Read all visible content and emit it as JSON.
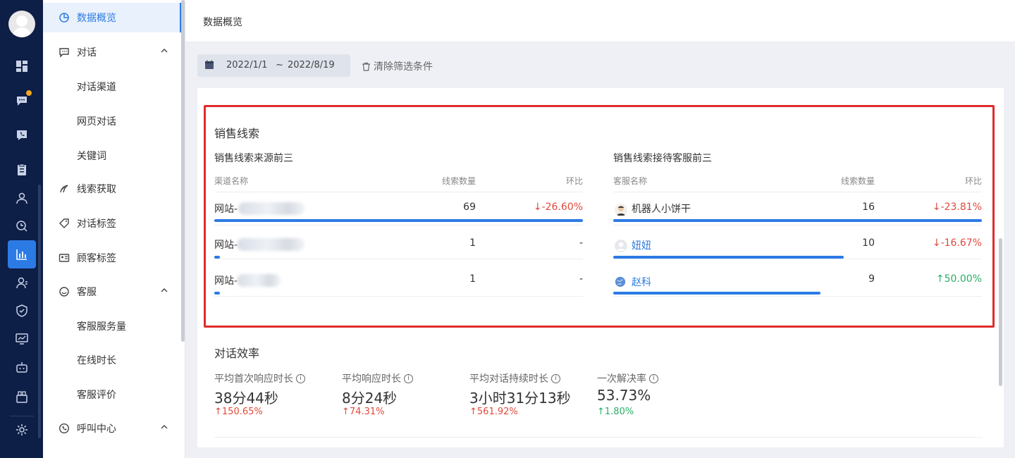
{
  "header": {
    "title": "数据概览"
  },
  "menu": {
    "items": [
      {
        "label": "数据概览",
        "icon": "pie-chart-icon"
      },
      {
        "label": "对话",
        "icon": "chat-bubble-icon"
      },
      {
        "label": "对话渠道"
      },
      {
        "label": "网页对话"
      },
      {
        "label": "关键词"
      },
      {
        "label": "线索获取",
        "icon": "lead-icon"
      },
      {
        "label": "对话标签",
        "icon": "tag-icon"
      },
      {
        "label": "顾客标签",
        "icon": "id-card-icon"
      },
      {
        "label": "客服",
        "icon": "service-icon"
      },
      {
        "label": "客服服务量"
      },
      {
        "label": "在线时长"
      },
      {
        "label": "客服评价"
      },
      {
        "label": "呼叫中心",
        "icon": "phone-icon"
      }
    ]
  },
  "filter": {
    "date_start": "2022/1/1",
    "date_sep": "~",
    "date_end": "2022/8/19",
    "clear_label": "清除筛选条件"
  },
  "sales_leads": {
    "title": "销售线索",
    "sources": {
      "title": "销售线索来源前三",
      "headers": [
        "渠道名称",
        "线索数量",
        "环比"
      ],
      "rows": [
        {
          "name": "网站-",
          "count": "69",
          "change": "-26.60%",
          "direction": "down",
          "share": 1.0
        },
        {
          "name": "网站-",
          "count": "1",
          "change": "-",
          "direction": "none",
          "share": 0.015
        },
        {
          "name": "网站-",
          "count": "1",
          "change": "-",
          "direction": "none",
          "share": 0.015
        }
      ]
    },
    "agents": {
      "title": "销售线索接待客服前三",
      "headers": [
        "客服名称",
        "线索数量",
        "环比"
      ],
      "rows": [
        {
          "name": "机器人小饼干",
          "count": "16",
          "change": "-23.81%",
          "direction": "down",
          "share": 1.0
        },
        {
          "name": "妞妞",
          "count": "10",
          "change": "-16.67%",
          "direction": "down",
          "share": 0.625
        },
        {
          "name": "赵科",
          "count": "9",
          "change": "50.00%",
          "direction": "up",
          "share": 0.5625
        }
      ]
    }
  },
  "efficiency": {
    "title": "对话效率",
    "metrics": [
      {
        "label": "平均首次响应时长",
        "value": "38分44秒",
        "change": "150.65%",
        "direction": "up",
        "color": "#e04a3b"
      },
      {
        "label": "平均响应时长",
        "value": "8分24秒",
        "change": "74.31%",
        "direction": "up",
        "color": "#e04a3b"
      },
      {
        "label": "平均对话持续时长",
        "value": "3小时31分13秒",
        "change": "561.92%",
        "direction": "up",
        "color": "#e04a3b"
      },
      {
        "label": "一次解决率",
        "value": "53.73%",
        "change": "1.80%",
        "direction": "up",
        "color": "#2aae67"
      }
    ]
  },
  "colors": {
    "accent": "#2c7be5",
    "rail": "#0d1e47",
    "down": "#e04a3b",
    "up": "#2aae67",
    "highlight": "#e02b2b"
  }
}
